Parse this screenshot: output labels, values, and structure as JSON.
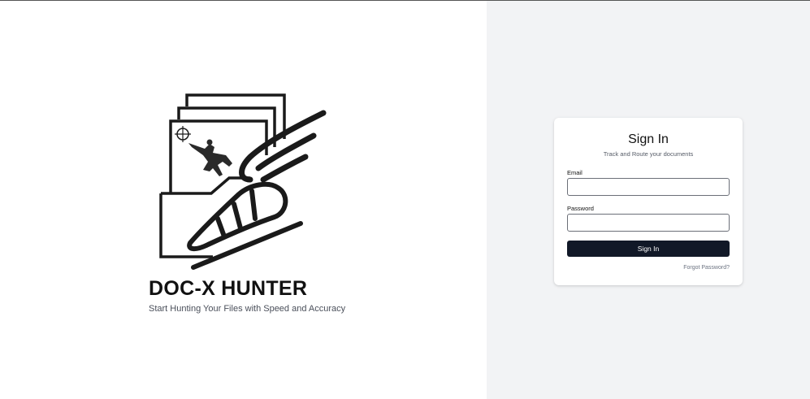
{
  "brand": {
    "title": "DOC-X HUNTER",
    "tagline": "Start Hunting Your Files with Speed and Accuracy",
    "logo_icon": "winged-shoe-documents-logo"
  },
  "signin": {
    "title": "Sign In",
    "subtitle": "Track and Route your documents",
    "email_label": "Email",
    "email_value": "",
    "password_label": "Password",
    "password_value": "",
    "button_label": "Sign In",
    "forgot_label": "Forgot Password?"
  },
  "colors": {
    "left_bg": "#ffffff",
    "right_bg": "#f2f3f5",
    "button_bg": "#111827",
    "button_text": "#ffffff"
  }
}
